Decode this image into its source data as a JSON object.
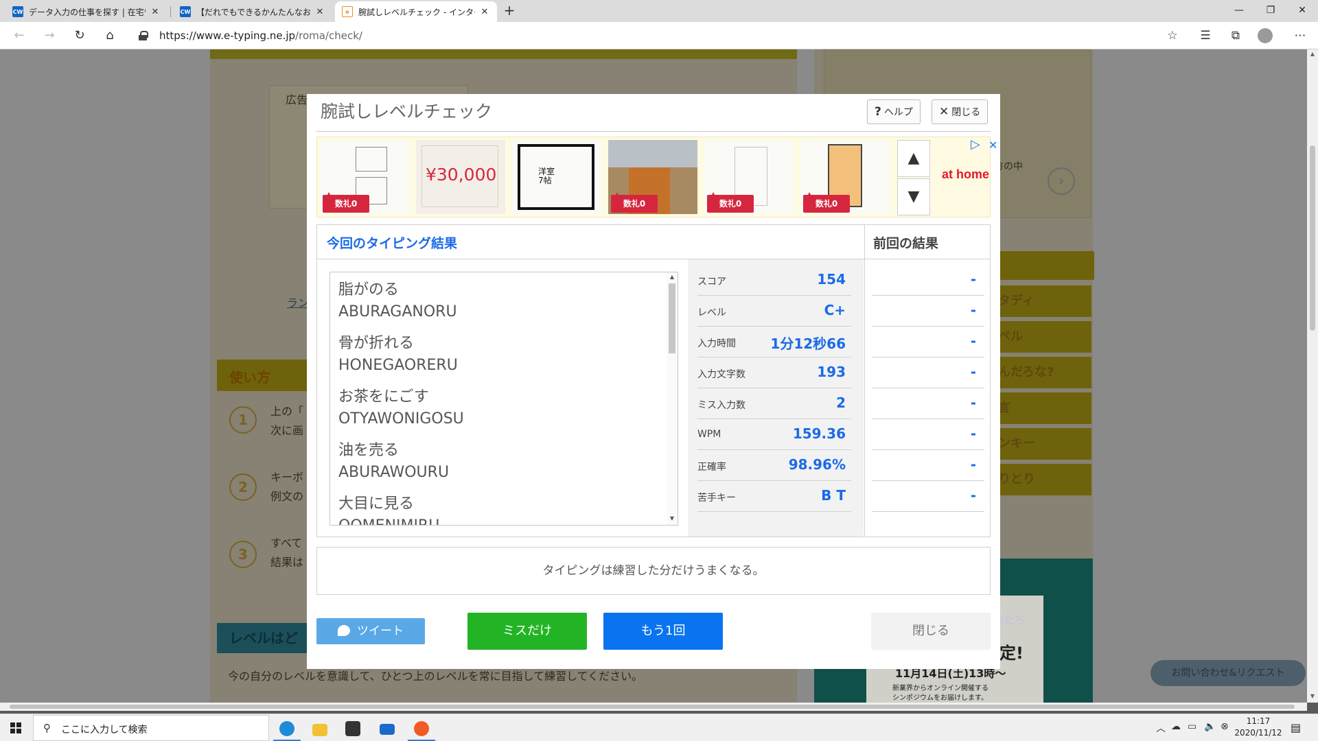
{
  "browser": {
    "tabs": [
      {
        "title": "データ入力の仕事を探す | 在宅ワーク",
        "favicon": "CW"
      },
      {
        "title": "【だれでもできるかんたんなお仕事！】",
        "favicon": "CW"
      },
      {
        "title": "腕試しレベルチェック - インターネットで",
        "favicon": "e-typing"
      }
    ],
    "url_host": "https://www.e-typing.ne.jp",
    "url_path": "/roma/check/"
  },
  "modal": {
    "title": "腕試しレベルチェック",
    "help_label": "ヘルプ",
    "close_label": "閉じる",
    "ad": {
      "badge": "数礼0",
      "price": "¥30,000",
      "floorplan_text": "洋室\n7帖",
      "brand": "at home"
    },
    "results": {
      "current_heading": "今回のタイピング結果",
      "previous_heading": "前回の結果",
      "words": [
        {
          "jp": "脂がのる",
          "romaji": "ABURAGANORU"
        },
        {
          "jp": "骨が折れる",
          "romaji": "HONEGAORERU"
        },
        {
          "jp": "お茶をにごす",
          "romaji": "OTYAWONIGOSU"
        },
        {
          "jp": "油を売る",
          "romaji": "ABURAWOURU"
        },
        {
          "jp": "大目に見る",
          "romaji": "OOMENIMIRU"
        }
      ],
      "stats": [
        {
          "label": "スコア",
          "value": "154",
          "previous": "-"
        },
        {
          "label": "レベル",
          "value": "C+",
          "previous": "-"
        },
        {
          "label": "入力時間",
          "value": "1分12秒66",
          "previous": "-"
        },
        {
          "label": "入力文字数",
          "value": "193",
          "previous": "-"
        },
        {
          "label": "ミス入力数",
          "value": "2",
          "previous": "-"
        },
        {
          "label": "WPM",
          "value": "159.36",
          "previous": "-"
        },
        {
          "label": "正確率",
          "value": "98.96%",
          "previous": "-"
        },
        {
          "label": "苦手キー",
          "value": "B T",
          "previous": "-"
        }
      ]
    },
    "message": "タイピングは練習した分だけうまくなる。",
    "buttons": {
      "tweet": "ツイート",
      "miss_only": "ミスだけ",
      "retry": "もう1回",
      "close": "閉じる"
    }
  },
  "background_page": {
    "ad_label": "広告",
    "usage_heading": "使い方",
    "steps": [
      {
        "num": "1",
        "text1": "上の「",
        "text2": "次に画"
      },
      {
        "num": "2",
        "text1": "キーボ",
        "text2": "例文の"
      },
      {
        "num": "3",
        "text1": "すべて",
        "text2": "結果は"
      }
    ],
    "link_fragment": "ラン",
    "level_heading": "レベルはど",
    "level_text": "今の自分のレベルを意識して、ひとつ上のレベルを常に目指して練習してください。",
    "right_text": "方の中",
    "side_nav": [
      "スタディ",
      "ラベル",
      "なんだろな?",
      "方言",
      "ランキー",
      "しりとり"
    ],
    "event_title": "性たち",
    "event_confirmed": "定!",
    "event_date": "11月14日(土)13時～",
    "event_sub1": "新業界からオンライン開催する",
    "event_sub2": "シンポジウムをお届けします。",
    "contact_button": "お問い合わせ&リクエスト"
  },
  "taskbar": {
    "search_placeholder": "ここに入力して検索",
    "time": "11:17",
    "date": "2020/11/12"
  },
  "colors": {
    "accent_blue": "#1a6ae8",
    "miss_button": "#22b425",
    "retry_button": "#0a74f0",
    "tweet_button": "#5aa8e6",
    "ad_badge": "#d6263e"
  }
}
